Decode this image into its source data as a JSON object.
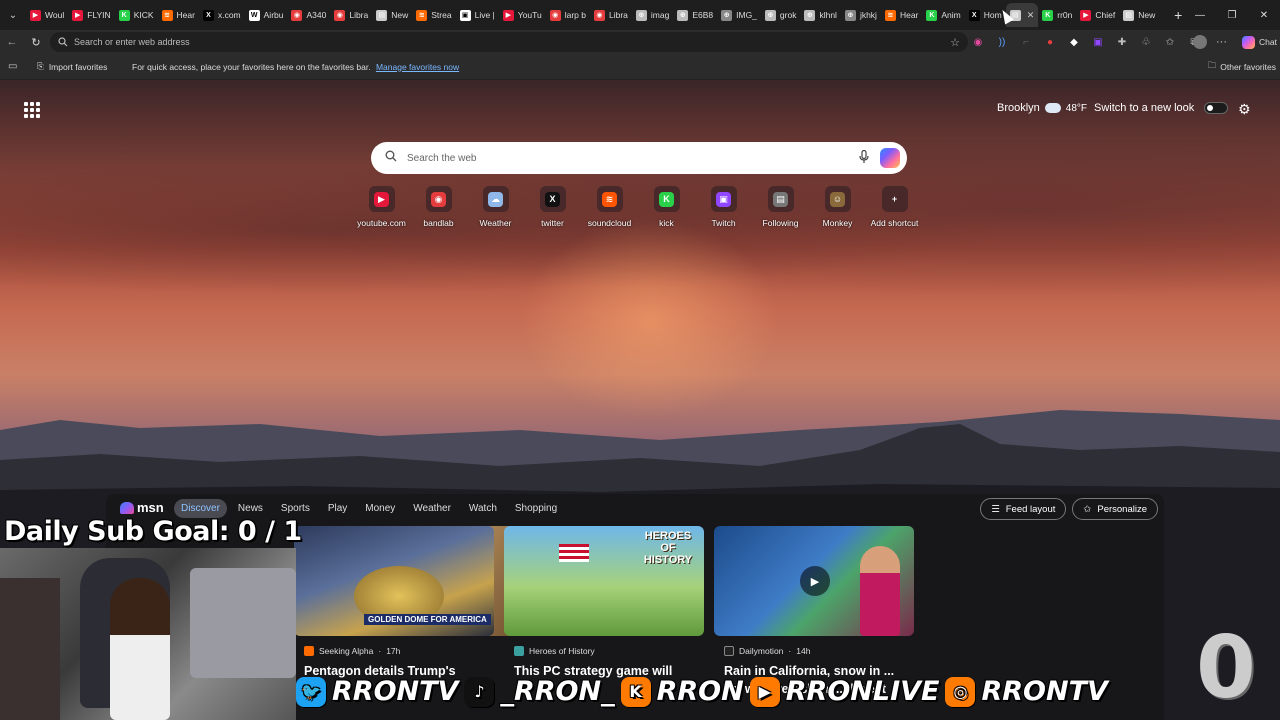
{
  "tabs": [
    {
      "label": "Woul",
      "color": "#e5173a",
      "glyph": "▶"
    },
    {
      "label": "FLYIN",
      "color": "#e5173a",
      "glyph": "▶"
    },
    {
      "label": "KICK",
      "color": "#29d14a",
      "glyph": "K"
    },
    {
      "label": "Hear",
      "color": "#ff6a00",
      "glyph": "≋"
    },
    {
      "label": "x.com",
      "color": "#000000",
      "glyph": "X"
    },
    {
      "label": "Airbu",
      "color": "#ffffff",
      "glyph": "W"
    },
    {
      "label": "A340",
      "color": "#e53d3d",
      "glyph": "◉"
    },
    {
      "label": "Libra",
      "color": "#e53d3d",
      "glyph": "◉"
    },
    {
      "label": "New",
      "color": "#cccccc",
      "glyph": "▤"
    },
    {
      "label": "Strea",
      "color": "#ff6a00",
      "glyph": "≋"
    },
    {
      "label": "Live |",
      "color": "#ffffff",
      "glyph": "▣"
    },
    {
      "label": "YouTu",
      "color": "#e5173a",
      "glyph": "▶"
    },
    {
      "label": "larp b",
      "color": "#e53d3d",
      "glyph": "◉"
    },
    {
      "label": "Libra",
      "color": "#e53d3d",
      "glyph": "◉"
    },
    {
      "label": "imag",
      "color": "#bbbbbb",
      "glyph": "⊕"
    },
    {
      "label": "E6B8",
      "color": "#bbbbbb",
      "glyph": "⊕"
    },
    {
      "label": "IMG_",
      "color": "#888888",
      "glyph": "⊕"
    },
    {
      "label": "grok",
      "color": "#bbbbbb",
      "glyph": "⊕"
    },
    {
      "label": "klhnl",
      "color": "#bbbbbb",
      "glyph": "⊕"
    },
    {
      "label": "jkhkj",
      "color": "#888888",
      "glyph": "⊕"
    },
    {
      "label": "Hear",
      "color": "#ff6a00",
      "glyph": "≋"
    },
    {
      "label": "Anim",
      "color": "#29d14a",
      "glyph": "K"
    },
    {
      "label": "Hom",
      "color": "#000000",
      "glyph": "X"
    },
    {
      "label": "",
      "color": "#cccccc",
      "glyph": "▤",
      "active": true
    },
    {
      "label": "rr0n",
      "color": "#29d14a",
      "glyph": "K"
    },
    {
      "label": "Chief",
      "color": "#e5173a",
      "glyph": "▶"
    },
    {
      "label": "New",
      "color": "#cccccc",
      "glyph": "▤"
    }
  ],
  "toolbar": {
    "address_placeholder": "Search or enter web address",
    "copilot_label": "Chat"
  },
  "favorites_bar": {
    "import_label": "Import favorites",
    "message": "For quick access, place your favorites here on the favorites bar.",
    "manage_link": "Manage favorites now",
    "other_favorites": "Other favorites"
  },
  "ntp": {
    "location": "Brooklyn",
    "temperature": "48",
    "temp_unit": "°F",
    "new_look_label": "Switch to a new look",
    "search_placeholder": "Search the web",
    "shortcuts": [
      {
        "label": "youtube.com",
        "color": "#e5173a",
        "glyph": "▶"
      },
      {
        "label": "bandlab",
        "color": "#e53d3d",
        "glyph": "◉"
      },
      {
        "label": "Weather",
        "color": "#8fb8e8",
        "glyph": "☁"
      },
      {
        "label": "twitter",
        "color": "#111111",
        "glyph": "X"
      },
      {
        "label": "soundcloud",
        "color": "#ff5500",
        "glyph": "≋"
      },
      {
        "label": "kick",
        "color": "#29d14a",
        "glyph": "K"
      },
      {
        "label": "Twitch",
        "color": "#9146ff",
        "glyph": "▣"
      },
      {
        "label": "Following",
        "color": "#777777",
        "glyph": "▤"
      },
      {
        "label": "Monkey",
        "color": "#8a6a3a",
        "glyph": "☺"
      },
      {
        "label": "Add shortcut",
        "color": "transparent",
        "glyph": "+"
      }
    ]
  },
  "msn": {
    "logo_text": "msn",
    "nav": [
      "Discover",
      "News",
      "Sports",
      "Play",
      "Money",
      "Weather",
      "Watch",
      "Shopping"
    ],
    "active_nav": "Discover",
    "feed_layout_label": "Feed layout",
    "personalize_label": "Personalize",
    "cards": [
      {
        "source": "Seeking Alpha",
        "age": "17h",
        "title": "Pentagon details Trump's",
        "image_text": "GOLDEN DOME FOR AMERICA",
        "source_color": "#ff6a00"
      },
      {
        "source": "Heroes of History",
        "age": "",
        "title": "This PC strategy game will",
        "image_text": "HEROES OF HISTORY",
        "source_color": "#3aa0a0"
      },
      {
        "source": "Dailymotion",
        "age": "14h",
        "title": "Rain in California, snow in ... es, wildfire risk in ... thwest",
        "image_text": "",
        "source_color": "#222222"
      }
    ]
  },
  "overlay": {
    "sub_goal": "Daily Sub Goal:  0 / 1",
    "socials": [
      {
        "handle": "RRONTV",
        "color": "#1da1f2",
        "glyph": "🐦"
      },
      {
        "handle": "_RRON_",
        "color": "#111111",
        "glyph": "♪"
      },
      {
        "handle": "RRON",
        "color": "#ff7a00",
        "glyph": "K"
      },
      {
        "handle": "RRONLIVE",
        "color": "#ff7a00",
        "glyph": "▶"
      },
      {
        "handle": "RRONTV",
        "color": "#ff7a00",
        "glyph": "◎"
      }
    ],
    "counter": "0"
  }
}
